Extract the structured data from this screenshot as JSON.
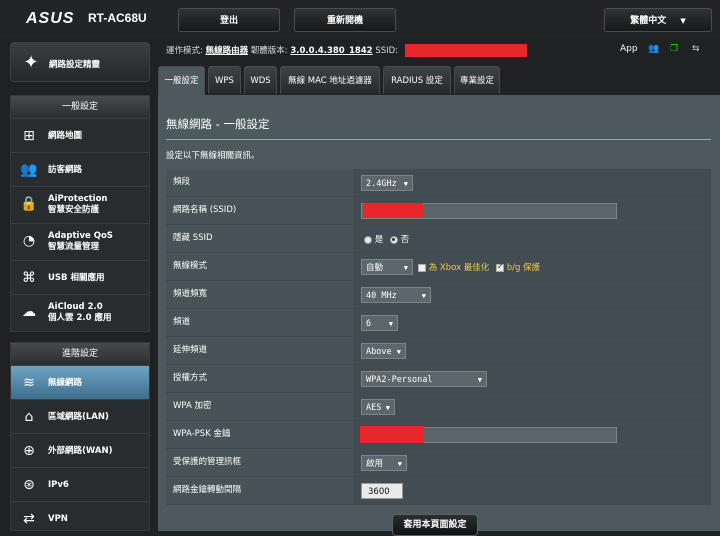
{
  "header": {
    "brand": "ASUS",
    "model": "RT-AC68U",
    "logout_label": "登出",
    "reboot_label": "重新開機",
    "language": "繁體中文"
  },
  "sidebar": {
    "quick_setup": "網路設定精靈",
    "general_heading": "一般設定",
    "general_items": [
      {
        "label": "網路地圖",
        "icon": "network-map-icon"
      },
      {
        "label": "訪客網路",
        "icon": "guest-network-icon"
      },
      {
        "label": "AiProtection",
        "label2": "智慧安全防護",
        "icon": "aiprotection-icon"
      },
      {
        "label": "Adaptive QoS",
        "label2": "智慧流量管理",
        "icon": "qos-gauge-icon"
      },
      {
        "label": "USB 相關應用",
        "icon": "usb-icon"
      },
      {
        "label": "AiCloud 2.0",
        "label2": "個人雲 2.0 應用",
        "icon": "cloud-icon"
      }
    ],
    "advanced_heading": "進階設定",
    "advanced_items": [
      {
        "label": "無線網路",
        "icon": "wireless-icon"
      },
      {
        "label": "區域網路(LAN)",
        "icon": "home-icon"
      },
      {
        "label": "外部網路(WAN)",
        "icon": "globe-icon"
      },
      {
        "label": "IPv6",
        "icon": "ipv6-icon"
      },
      {
        "label": "VPN",
        "icon": "vpn-icon"
      }
    ]
  },
  "status": {
    "mode_label": "運作模式:",
    "mode_value": "無線路由器",
    "firmware_label": "韌體版本:",
    "firmware_value": "3.0.0.4.380_1842",
    "ssid_label": "SSID:",
    "app_label": "App"
  },
  "tabs": [
    "一般設定",
    "WPS",
    "WDS",
    "無線 MAC 地址過濾器",
    "RADIUS 設定",
    "專業設定"
  ],
  "panel": {
    "title": "無線網路 - 一般設定",
    "description": "設定以下無線相關資訊。"
  },
  "form": {
    "band_label": "頻段",
    "band_value": "2.4GHz",
    "ssid_label": "網路名稱 (SSID)",
    "hide_ssid_label": "隱藏 SSID",
    "hide_yes": "是",
    "hide_no": "否",
    "mode_label": "無線模式",
    "mode_value": "自動",
    "xbox_label": "為 Xbox 最佳化",
    "bg_label": "b/g 保護",
    "bandwidth_label": "頻道頻寬",
    "bandwidth_value": "40 MHz",
    "channel_label": "頻道",
    "channel_value": "6",
    "ext_channel_label": "延伸頻道",
    "ext_channel_value": "Above",
    "auth_label": "授權方式",
    "auth_value": "WPA2-Personal",
    "wpa_enc_label": "WPA 加密",
    "wpa_enc_value": "AES",
    "psk_label": "WPA-PSK 金鑰",
    "pmf_label": "受保護的管理訊框",
    "pmf_value": "啟用",
    "rotation_label": "網路金鑰轉動間隔",
    "rotation_value": "3600"
  },
  "apply_label": "套用本頁面設定",
  "colors": {
    "panel": "#4d595d",
    "active_item": "#5b94b8",
    "redaction": "#e8262b"
  }
}
